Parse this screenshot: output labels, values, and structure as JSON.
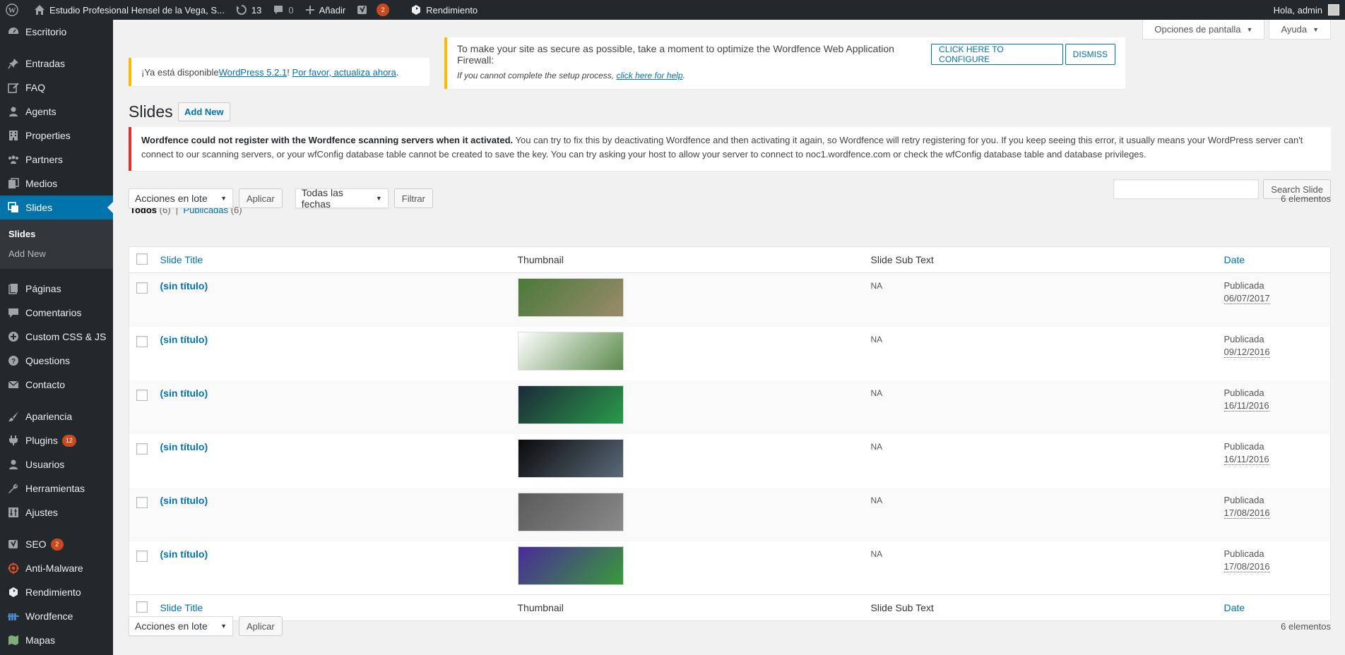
{
  "adminbar": {
    "site_name": "Estudio Profesional Hensel de la Vega, S...",
    "updates_count": "13",
    "comments_count": "0",
    "new_label": "Añadir",
    "yoast_badge": "2",
    "performance_label": "Rendimiento",
    "greeting": "Hola, admin"
  },
  "sidebar": {
    "items": [
      {
        "label": "Escritorio",
        "icon": "dashboard-icon"
      },
      {
        "label": "Entradas",
        "icon": "pin-icon"
      },
      {
        "label": "FAQ",
        "icon": "edit-icon"
      },
      {
        "label": "Agents",
        "icon": "user-icon"
      },
      {
        "label": "Properties",
        "icon": "building-icon"
      },
      {
        "label": "Partners",
        "icon": "groups-icon"
      },
      {
        "label": "Medios",
        "icon": "media-icon"
      },
      {
        "label": "Slides",
        "icon": "slides-icon"
      },
      {
        "label": "Páginas",
        "icon": "pages-icon"
      },
      {
        "label": "Comentarios",
        "icon": "comment-icon"
      },
      {
        "label": "Custom CSS & JS",
        "icon": "plus-circle-icon"
      },
      {
        "label": "Questions",
        "icon": "question-icon"
      },
      {
        "label": "Contacto",
        "icon": "mail-icon"
      },
      {
        "label": "Apariencia",
        "icon": "brush-icon"
      },
      {
        "label": "Plugins",
        "icon": "plugin-icon",
        "badge": "12"
      },
      {
        "label": "Usuarios",
        "icon": "users-icon"
      },
      {
        "label": "Herramientas",
        "icon": "wrench-icon"
      },
      {
        "label": "Ajustes",
        "icon": "settings-icon"
      },
      {
        "label": "SEO",
        "icon": "yoast-icon",
        "badge": "2"
      },
      {
        "label": "Anti-Malware",
        "icon": "shield-icon"
      },
      {
        "label": "Rendimiento",
        "icon": "performance-icon"
      },
      {
        "label": "Wordfence",
        "icon": "wordfence-icon"
      },
      {
        "label": "Mapas",
        "icon": "map-icon"
      }
    ],
    "submenu": {
      "current": "Slides",
      "add_new": "Add New"
    }
  },
  "screen_options": {
    "options": "Opciones de pantalla",
    "help": "Ayuda"
  },
  "update_notice": {
    "prefix": "¡Ya está disponible ",
    "version_link": "WordPress 5.2.1",
    "sep": "! ",
    "update_link": "Por favor, actualiza ahora",
    "suffix": "."
  },
  "wordfence_notice": {
    "text": "To make your site as secure as possible, take a moment to optimize the Wordfence Web Application Firewall:",
    "configure_btn": "CLICK HERE TO CONFIGURE",
    "dismiss_btn": "DISMISS",
    "help_prefix": "If you cannot complete the setup process, ",
    "help_link": "click here for help",
    "help_suffix": "."
  },
  "page": {
    "title": "Slides",
    "add_new": "Add New"
  },
  "error_notice": {
    "bold": "Wordfence could not register with the Wordfence scanning servers when it activated.",
    "text": " You can try to fix this by deactivating Wordfence and then activating it again, so Wordfence will retry registering for you. If you keep seeing this error, it usually means your WordPress server can't connect to our scanning servers, or your wfConfig database table cannot be created to save the key. You can try asking your host to allow your server to connect to noc1.wordfence.com or check the wfConfig database table and database privileges."
  },
  "filters": {
    "all_label": "Todos",
    "all_count": "(6)",
    "sep": " | ",
    "published_label": "Publicadas",
    "published_count": "(6)"
  },
  "search": {
    "button": "Search Slide",
    "value": ""
  },
  "tablenav": {
    "bulk_actions": "Acciones en lote",
    "apply": "Aplicar",
    "dates": "Todas las fechas",
    "filter": "Filtrar",
    "items": "6 elementos"
  },
  "columns": {
    "title": "Slide Title",
    "thumbnail": "Thumbnail",
    "subtext": "Slide Sub Text",
    "date": "Date"
  },
  "rows": [
    {
      "title": "(sin título)",
      "subtext": "NA",
      "status": "Publicada",
      "date": "06/07/2017",
      "thumb_colors": [
        "#4a7a3a",
        "#9a8a6a"
      ]
    },
    {
      "title": "(sin título)",
      "subtext": "NA",
      "status": "Publicada",
      "date": "09/12/2016",
      "thumb_colors": [
        "#ffffff",
        "#5a8a4a"
      ]
    },
    {
      "title": "(sin título)",
      "subtext": "NA",
      "status": "Publicada",
      "date": "16/11/2016",
      "thumb_colors": [
        "#1c2a3a",
        "#2a9a4a"
      ]
    },
    {
      "title": "(sin título)",
      "subtext": "NA",
      "status": "Publicada",
      "date": "16/11/2016",
      "thumb_colors": [
        "#0a0a0a",
        "#5a6a7a"
      ]
    },
    {
      "title": "(sin título)",
      "subtext": "NA",
      "status": "Publicada",
      "date": "17/08/2016",
      "thumb_colors": [
        "#5a5a5a",
        "#8a8a8a"
      ]
    },
    {
      "title": "(sin título)",
      "subtext": "NA",
      "status": "Publicada",
      "date": "17/08/2016",
      "thumb_colors": [
        "#4a2a9a",
        "#3a9a3a"
      ]
    }
  ]
}
